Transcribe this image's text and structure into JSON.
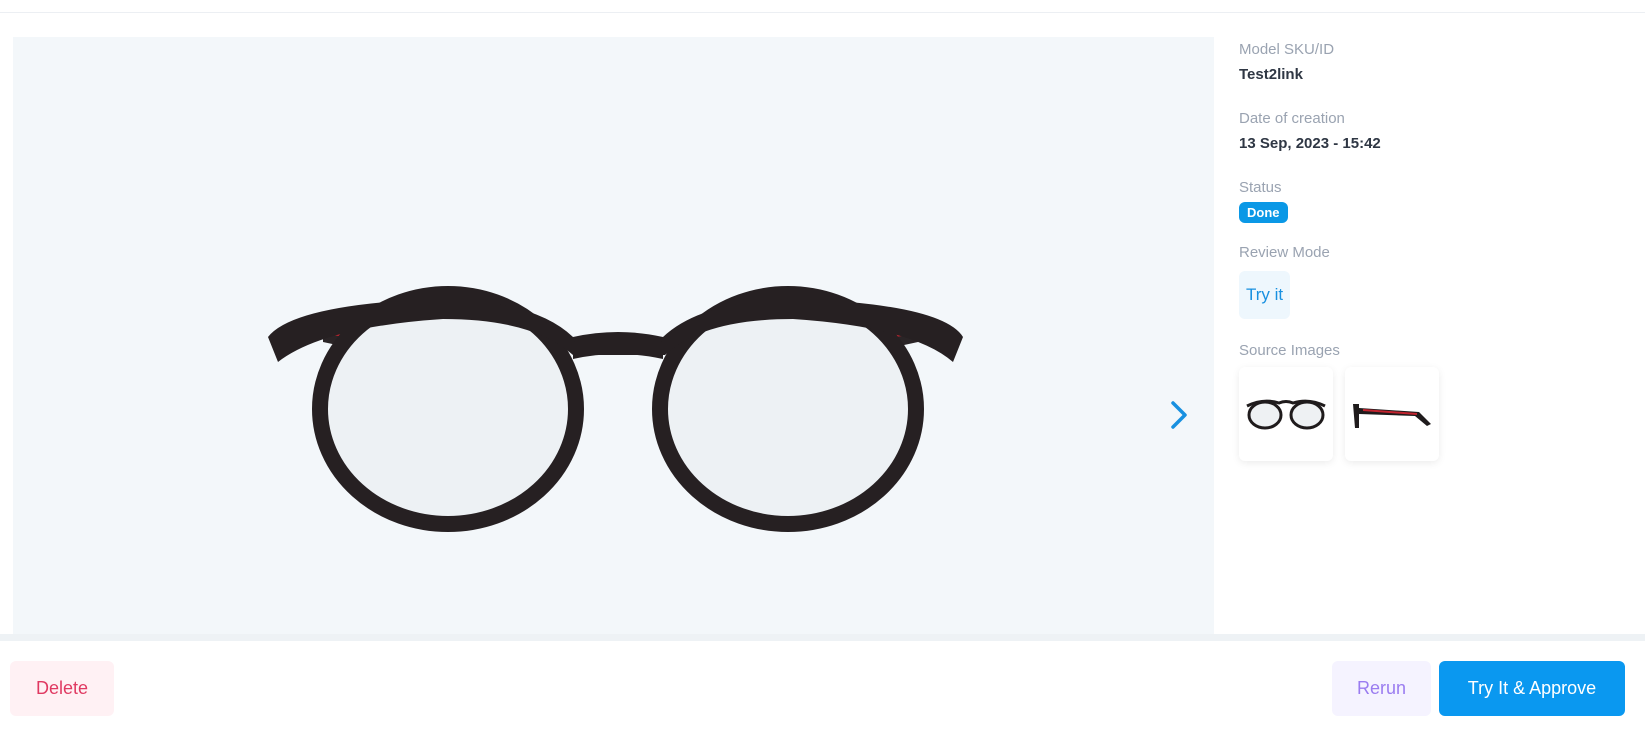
{
  "details": {
    "sku_label": "Model SKU/ID",
    "sku_value": "Test2link",
    "date_label": "Date of creation",
    "date_value": "13 Sep, 2023 - 15:42",
    "status_label": "Status",
    "status_value": "Done",
    "review_label": "Review Mode",
    "review_button": "Try it",
    "sources_label": "Source Images"
  },
  "viewer": {
    "next_icon": "chevron-right-icon"
  },
  "actions": {
    "delete": "Delete",
    "rerun": "Rerun",
    "approve": "Try It & Approve"
  },
  "colors": {
    "accent": "#0a98f0",
    "status_badge": "#0a98e6",
    "delete_text": "#e03a62",
    "rerun_text": "#9a7cf0"
  }
}
